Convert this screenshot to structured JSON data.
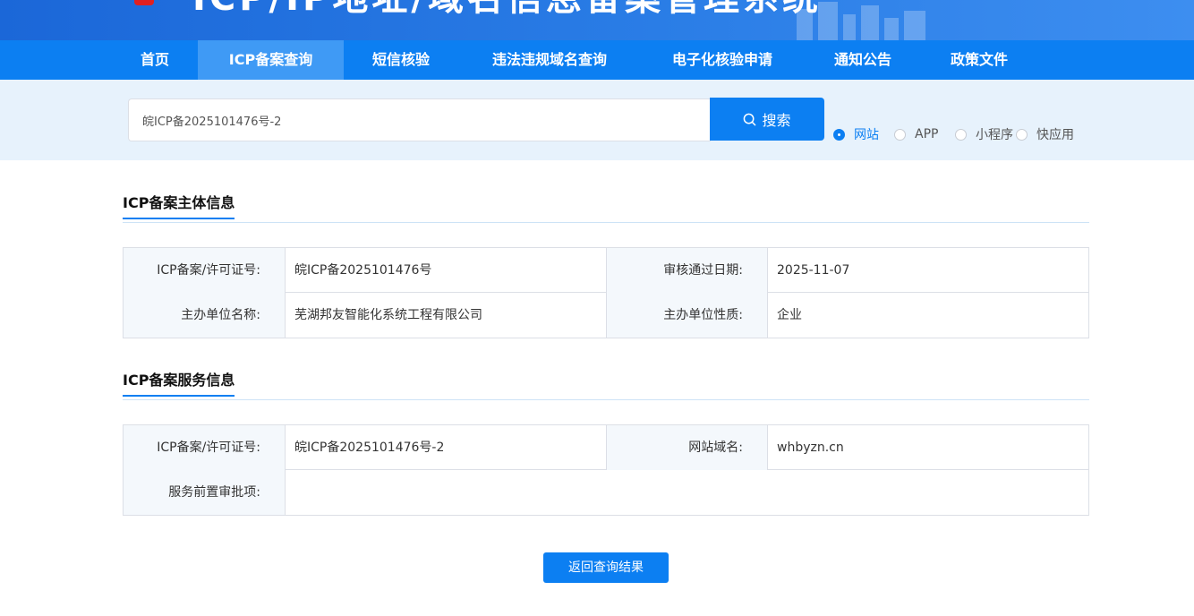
{
  "header": {
    "site_title": "ICP/IP地址/域名信息备案管理系统"
  },
  "nav": {
    "items": [
      {
        "label": "首页",
        "active": false
      },
      {
        "label": "ICP备案查询",
        "active": true
      },
      {
        "label": "短信核验",
        "active": false
      },
      {
        "label": "违法违规域名查询",
        "active": false
      },
      {
        "label": "电子化核验申请",
        "active": false
      },
      {
        "label": "通知公告",
        "active": false
      },
      {
        "label": "政策文件",
        "active": false
      }
    ]
  },
  "search": {
    "value": "皖ICP备2025101476号-2",
    "button_label": "搜索",
    "types": [
      {
        "label": "网站",
        "checked": true
      },
      {
        "label": "APP",
        "checked": false
      },
      {
        "label": "小程序",
        "checked": false
      },
      {
        "label": "快应用",
        "checked": false
      }
    ]
  },
  "subject_info": {
    "title": "ICP备案主体信息",
    "license_label": "ICP备案/许可证号:",
    "license_value": "皖ICP备2025101476号",
    "approve_date_label": "审核通过日期:",
    "approve_date_value": "2025-11-07",
    "org_name_label": "主办单位名称:",
    "org_name_value": "芜湖邦友智能化系统工程有限公司",
    "org_type_label": "主办单位性质:",
    "org_type_value": "企业"
  },
  "service_info": {
    "title": "ICP备案服务信息",
    "license_label": "ICP备案/许可证号:",
    "license_value": "皖ICP备2025101476号-2",
    "domain_label": "网站域名:",
    "domain_value": "whbyzn.cn",
    "pre_approval_label": "服务前置审批项:",
    "pre_approval_value": ""
  },
  "back_button": {
    "label": "返回查询结果"
  },
  "colors": {
    "primary": "#0c7ff2",
    "nav_active": "#3f9af5",
    "search_strip": "#e7f2fc",
    "label_cell": "#f4f8fc"
  }
}
